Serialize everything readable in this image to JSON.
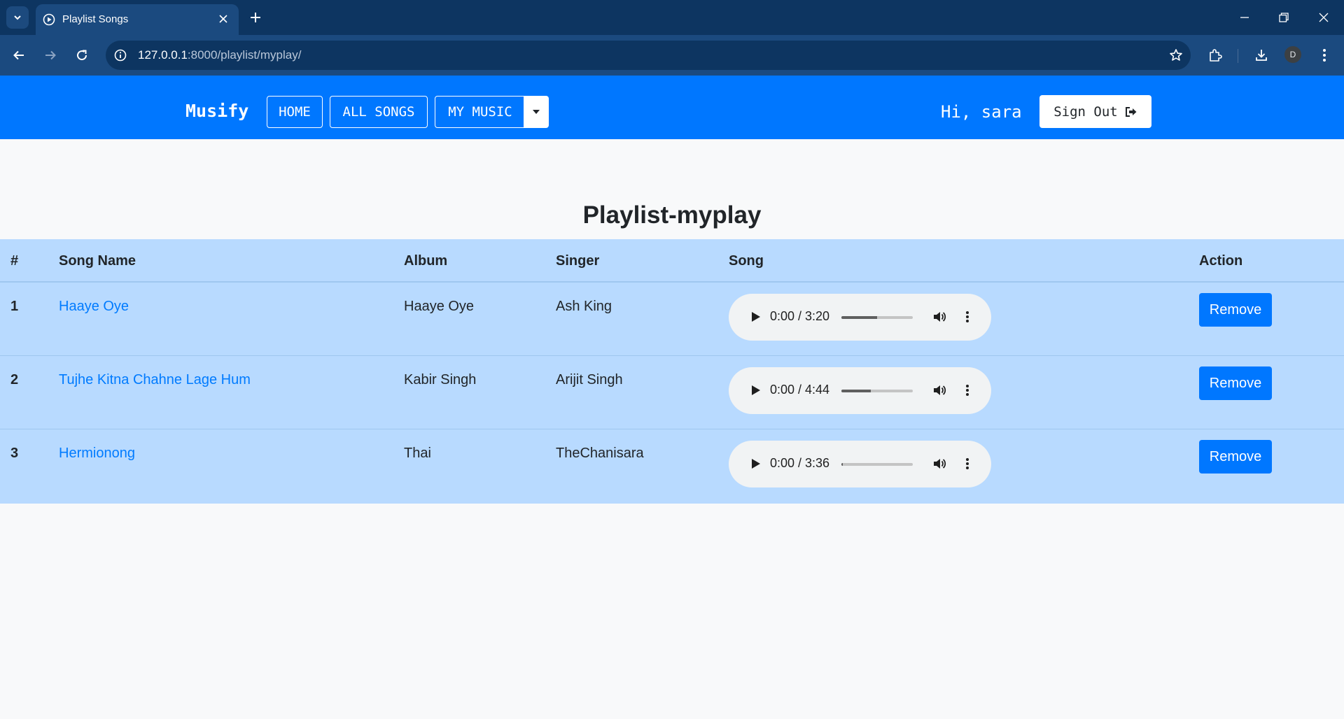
{
  "browser": {
    "tab_title": "Playlist Songs",
    "url_host": "127.0.0.1",
    "url_path": ":8000/playlist/myplay/",
    "profile_initial": "D"
  },
  "navbar": {
    "brand": "Musify",
    "home": "HOME",
    "all_songs": "ALL SONGS",
    "my_music": "MY MUSIC",
    "greeting": "Hi, sara",
    "sign_out": "Sign Out"
  },
  "page": {
    "title": "Playlist-myplay"
  },
  "table": {
    "headers": [
      "#",
      "Song Name",
      "Album",
      "Singer",
      "Song",
      "Action"
    ],
    "rows": [
      {
        "num": "1",
        "song": "Haaye Oye",
        "album": "Haaye Oye",
        "singer": "Ash King",
        "time": "0:00 / 3:20",
        "action": "Remove",
        "progress": 0.5
      },
      {
        "num": "2",
        "song": "Tujhe Kitna Chahne Lage Hum",
        "album": "Kabir Singh",
        "singer": "Arijit Singh",
        "time": "0:00 / 4:44",
        "action": "Remove",
        "progress": 0.41
      },
      {
        "num": "3",
        "song": "Hermionong",
        "album": "Thai",
        "singer": "TheChanisara",
        "time": "0:00 / 3:36",
        "action": "Remove",
        "progress": 0.02
      }
    ]
  },
  "colors": {
    "navbar": "#0077ff",
    "table_bg": "#b8daff",
    "link": "#007bff",
    "chrome_dark": "#0d3561",
    "chrome_light": "#1b4a7f"
  },
  "icons": [
    "tab-search-icon",
    "play-circle-icon",
    "close-icon",
    "plus-icon",
    "minimize-icon",
    "restore-icon",
    "back-icon",
    "forward-icon",
    "reload-icon",
    "info-icon",
    "star-icon",
    "extensions-icon",
    "download-icon",
    "kebab-icon",
    "caret-down-icon",
    "sign-out-icon",
    "play-icon",
    "volume-icon"
  ]
}
